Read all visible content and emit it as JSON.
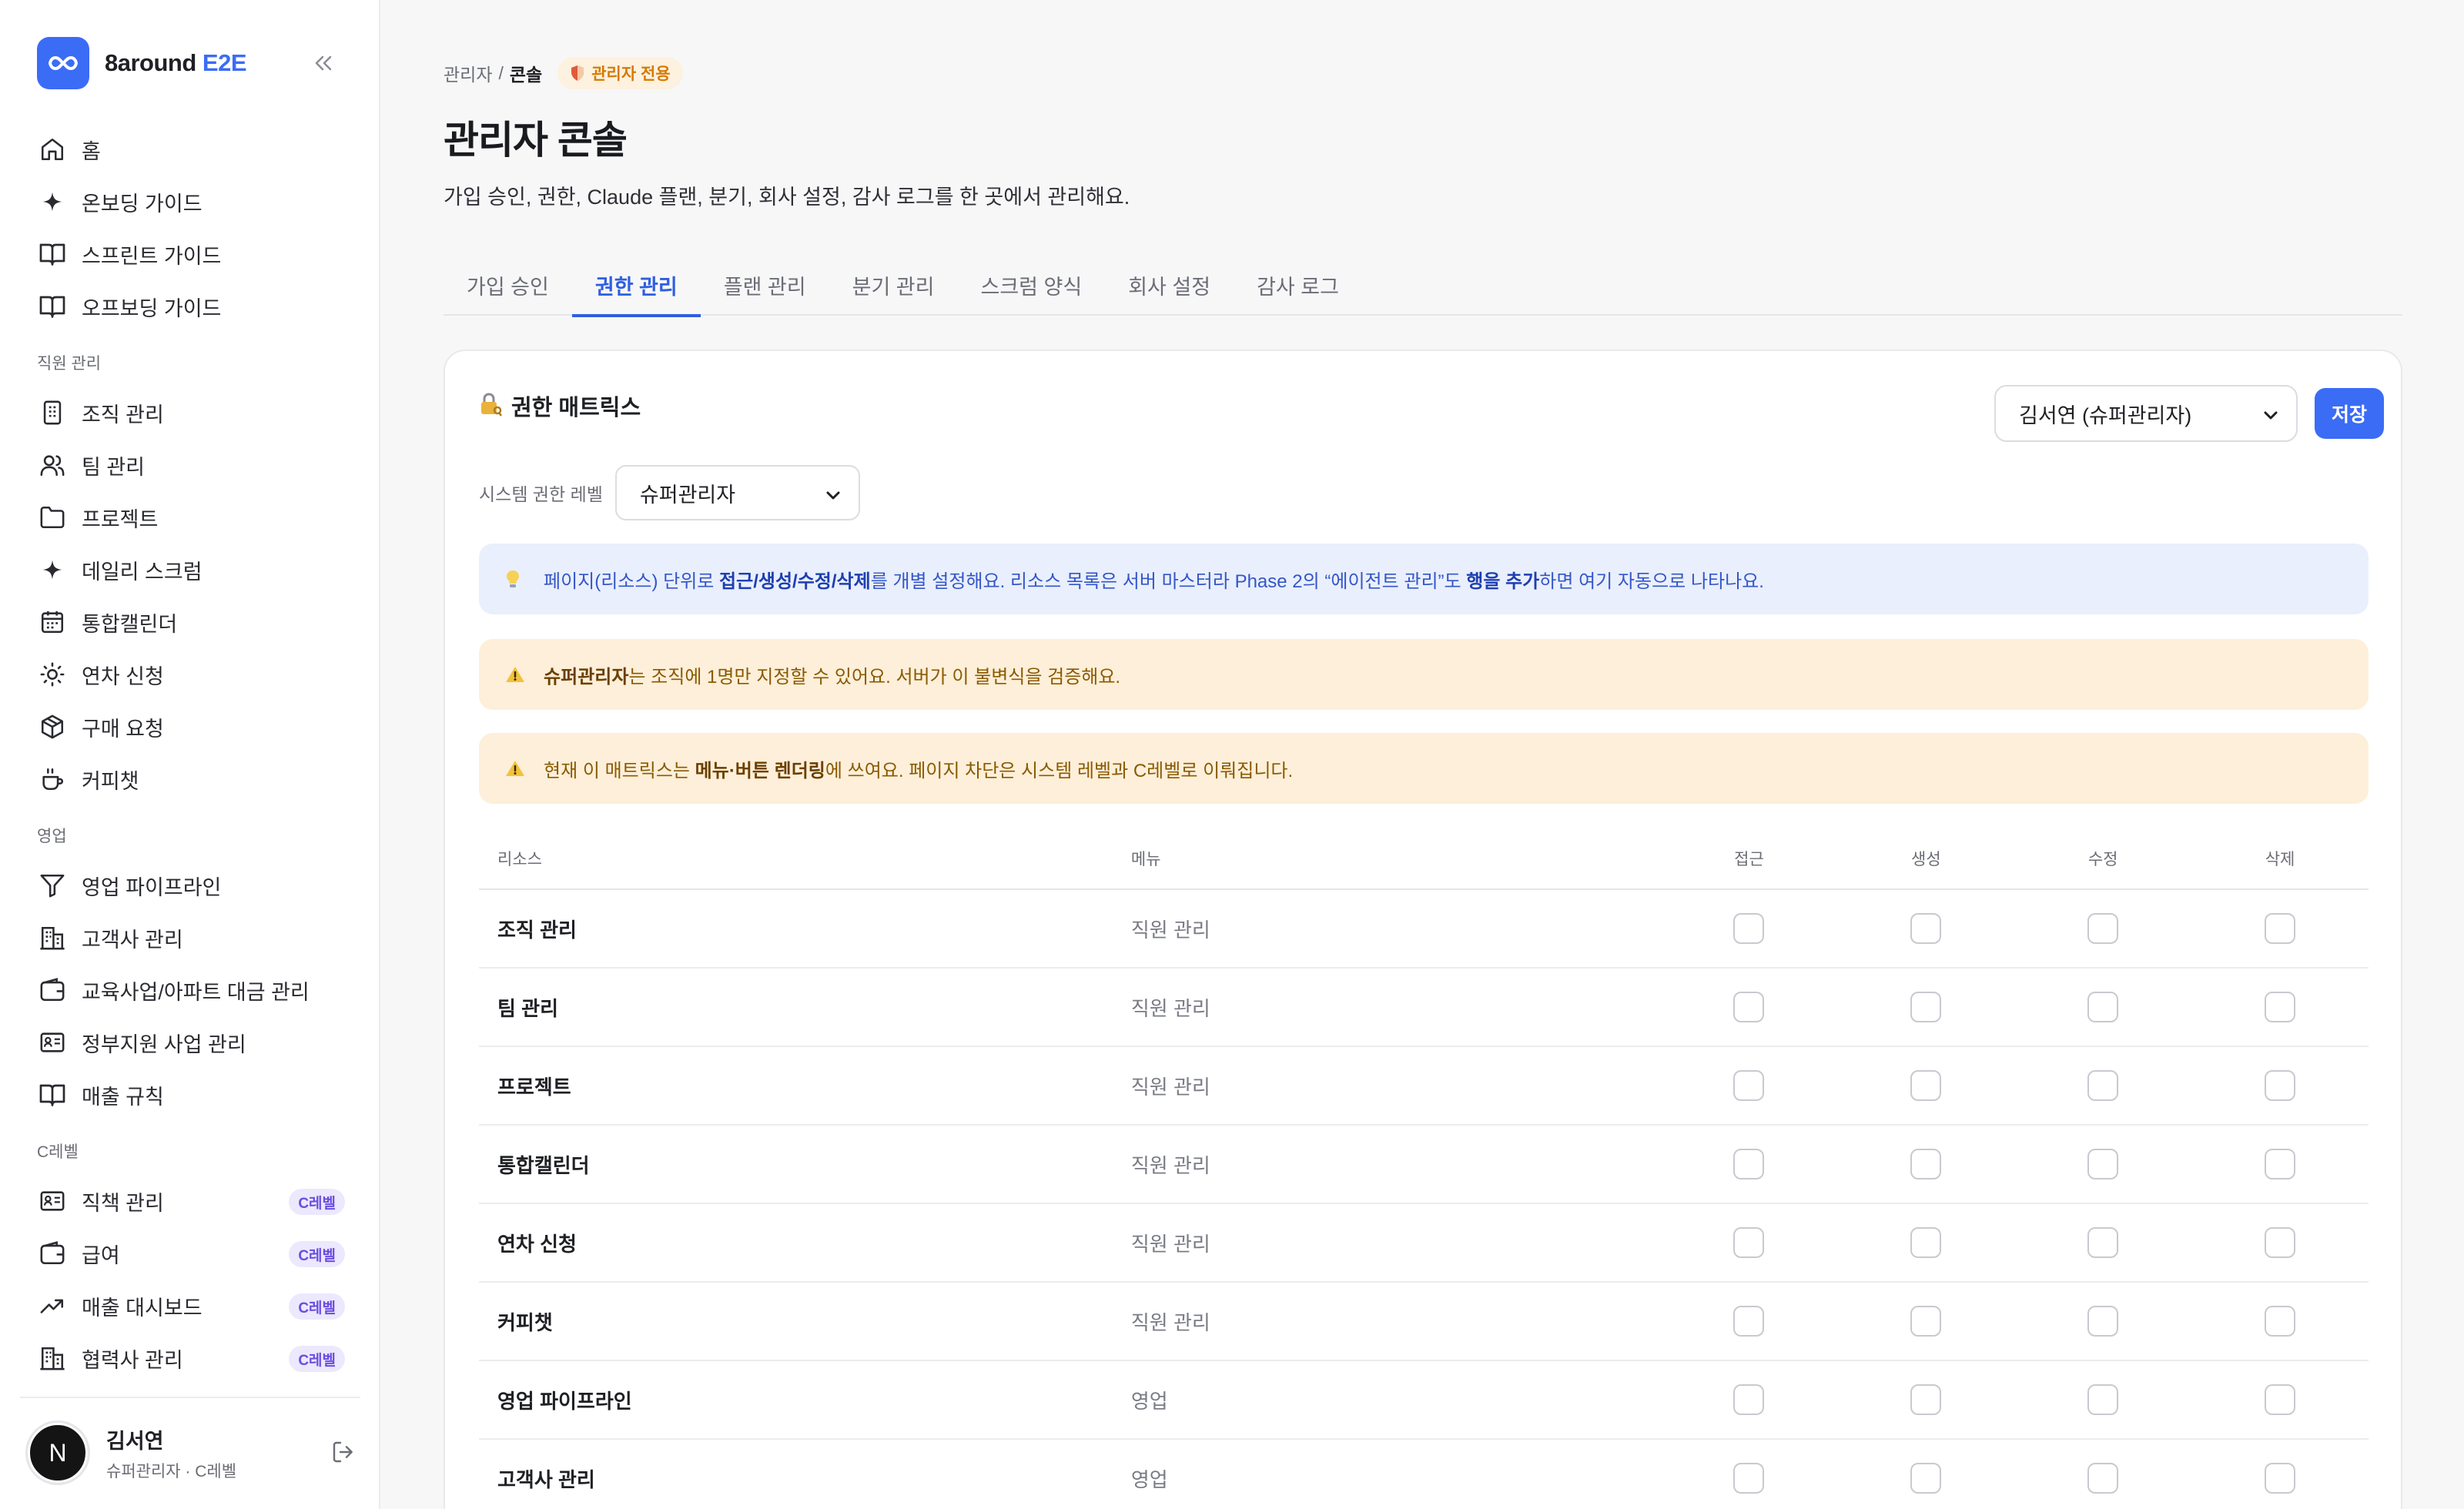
{
  "app": {
    "name_prefix": "8around",
    "name_accent": "E2E",
    "brand_color": "#3b6cf6"
  },
  "sidebar": {
    "items_top": [
      {
        "label": "홈",
        "icon": "home-icon"
      },
      {
        "label": "온보딩 가이드",
        "icon": "sparkle-icon"
      },
      {
        "label": "스프린트 가이드",
        "icon": "book-icon"
      },
      {
        "label": "오프보딩 가이드",
        "icon": "book-icon"
      }
    ],
    "section_staff": "직원 관리",
    "items_staff": [
      {
        "label": "조직 관리",
        "icon": "building-icon"
      },
      {
        "label": "팀 관리",
        "icon": "users-icon"
      },
      {
        "label": "프로젝트",
        "icon": "folder-icon"
      },
      {
        "label": "데일리 스크럼",
        "icon": "sparkle-icon"
      },
      {
        "label": "통합캘린더",
        "icon": "calendar-icon"
      },
      {
        "label": "연차 신청",
        "icon": "sun-icon"
      },
      {
        "label": "구매 요청",
        "icon": "box-icon"
      },
      {
        "label": "커피챗",
        "icon": "coffee-icon"
      }
    ],
    "section_sales": "영업",
    "items_sales": [
      {
        "label": "영업 파이프라인",
        "icon": "filter-icon"
      },
      {
        "label": "고객사 관리",
        "icon": "office-icon"
      },
      {
        "label": "교육사업/아파트 대금 관리",
        "icon": "wallet-icon"
      },
      {
        "label": "정부지원 사업 관리",
        "icon": "id-card-icon"
      },
      {
        "label": "매출 규칙",
        "icon": "book-icon"
      }
    ],
    "section_c": "C레벨",
    "items_c": [
      {
        "label": "직책 관리",
        "icon": "id-card-icon",
        "badge": "C레벨"
      },
      {
        "label": "급여",
        "icon": "wallet-icon",
        "badge": "C레벨"
      },
      {
        "label": "매출 대시보드",
        "icon": "trend-icon",
        "badge": "C레벨"
      },
      {
        "label": "협력사 관리",
        "icon": "office-icon",
        "badge": "C레벨"
      }
    ],
    "user": {
      "initial": "N",
      "name": "김서연",
      "role": "슈퍼관리자 · C레벨"
    }
  },
  "header": {
    "breadcrumb_parent": "관리자",
    "breadcrumb_sep": "/",
    "breadcrumb_current": "콘솔",
    "admin_badge": "관리자 전용",
    "title": "관리자 콘솔",
    "description": "가입 승인, 권한, Claude 플랜, 분기, 회사 설정, 감사 로그를 한 곳에서 관리해요."
  },
  "tabs": [
    {
      "label": "가입 승인",
      "active": false
    },
    {
      "label": "권한 관리",
      "active": true
    },
    {
      "label": "플랜 관리",
      "active": false
    },
    {
      "label": "분기 관리",
      "active": false
    },
    {
      "label": "스크럼 양식",
      "active": false
    },
    {
      "label": "회사 설정",
      "active": false
    },
    {
      "label": "감사 로그",
      "active": false
    }
  ],
  "matrix": {
    "title": "권한 매트릭스",
    "owner_select": "김서연 (슈퍼관리자)",
    "save_label": "저장",
    "level_label": "시스템 권한 레벨",
    "level_value": "슈퍼관리자",
    "notice_info": {
      "t1": "페이지(리소스) 단위로 ",
      "b1": "접근/생성/수정/삭제",
      "t2": "를 개별 설정해요. 리소스 목록은 서버 마스터라 Phase 2의 “에이전트 관리”도 ",
      "b2": "행을 추가",
      "t3": "하면 여기 자동으로 나타나요."
    },
    "notice_warn1": {
      "b1": "슈퍼관리자",
      "t1": "는 조직에 1명만 지정할 수 있어요. 서버가 이 불변식을 검증해요."
    },
    "notice_warn2": {
      "t1": "현재 이 매트릭스는 ",
      "b1": "메뉴·버튼 렌더링",
      "t2": "에 쓰여요. 페이지 차단은 시스템 레벨과 C레벨로 이뤄집니다."
    },
    "columns": {
      "resource": "리소스",
      "menu": "메뉴",
      "access": "접근",
      "create": "생성",
      "update": "수정",
      "delete": "삭제"
    },
    "rows": [
      {
        "resource": "조직 관리",
        "menu": "직원 관리"
      },
      {
        "resource": "팀 관리",
        "menu": "직원 관리"
      },
      {
        "resource": "프로젝트",
        "menu": "직원 관리"
      },
      {
        "resource": "통합캘린더",
        "menu": "직원 관리"
      },
      {
        "resource": "연차 신청",
        "menu": "직원 관리"
      },
      {
        "resource": "커피챗",
        "menu": "직원 관리"
      },
      {
        "resource": "영업 파이프라인",
        "menu": "영업"
      },
      {
        "resource": "고객사 관리",
        "menu": "영업"
      }
    ]
  }
}
